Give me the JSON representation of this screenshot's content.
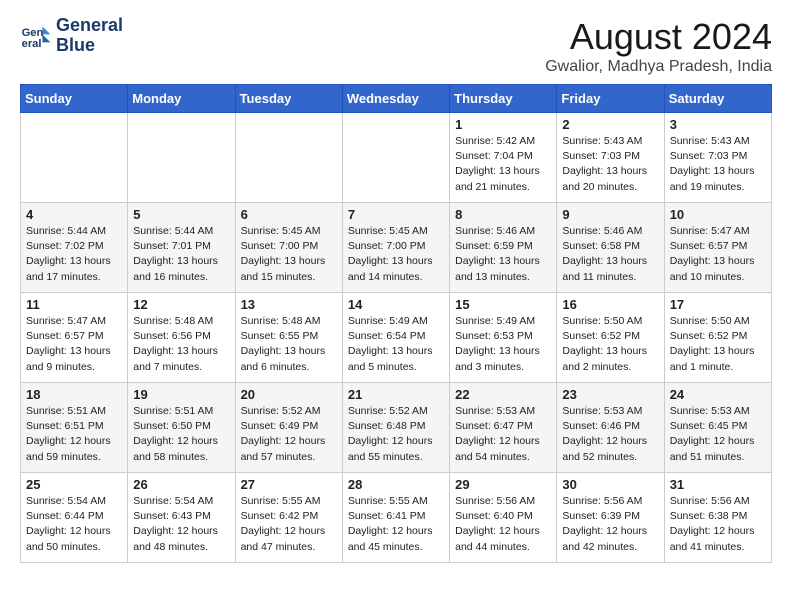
{
  "header": {
    "logo_line1": "General",
    "logo_line2": "Blue",
    "month": "August 2024",
    "location": "Gwalior, Madhya Pradesh, India"
  },
  "weekdays": [
    "Sunday",
    "Monday",
    "Tuesday",
    "Wednesday",
    "Thursday",
    "Friday",
    "Saturday"
  ],
  "weeks": [
    [
      {
        "day": "",
        "info": ""
      },
      {
        "day": "",
        "info": ""
      },
      {
        "day": "",
        "info": ""
      },
      {
        "day": "",
        "info": ""
      },
      {
        "day": "1",
        "info": "Sunrise: 5:42 AM\nSunset: 7:04 PM\nDaylight: 13 hours\nand 21 minutes."
      },
      {
        "day": "2",
        "info": "Sunrise: 5:43 AM\nSunset: 7:03 PM\nDaylight: 13 hours\nand 20 minutes."
      },
      {
        "day": "3",
        "info": "Sunrise: 5:43 AM\nSunset: 7:03 PM\nDaylight: 13 hours\nand 19 minutes."
      }
    ],
    [
      {
        "day": "4",
        "info": "Sunrise: 5:44 AM\nSunset: 7:02 PM\nDaylight: 13 hours\nand 17 minutes."
      },
      {
        "day": "5",
        "info": "Sunrise: 5:44 AM\nSunset: 7:01 PM\nDaylight: 13 hours\nand 16 minutes."
      },
      {
        "day": "6",
        "info": "Sunrise: 5:45 AM\nSunset: 7:00 PM\nDaylight: 13 hours\nand 15 minutes."
      },
      {
        "day": "7",
        "info": "Sunrise: 5:45 AM\nSunset: 7:00 PM\nDaylight: 13 hours\nand 14 minutes."
      },
      {
        "day": "8",
        "info": "Sunrise: 5:46 AM\nSunset: 6:59 PM\nDaylight: 13 hours\nand 13 minutes."
      },
      {
        "day": "9",
        "info": "Sunrise: 5:46 AM\nSunset: 6:58 PM\nDaylight: 13 hours\nand 11 minutes."
      },
      {
        "day": "10",
        "info": "Sunrise: 5:47 AM\nSunset: 6:57 PM\nDaylight: 13 hours\nand 10 minutes."
      }
    ],
    [
      {
        "day": "11",
        "info": "Sunrise: 5:47 AM\nSunset: 6:57 PM\nDaylight: 13 hours\nand 9 minutes."
      },
      {
        "day": "12",
        "info": "Sunrise: 5:48 AM\nSunset: 6:56 PM\nDaylight: 13 hours\nand 7 minutes."
      },
      {
        "day": "13",
        "info": "Sunrise: 5:48 AM\nSunset: 6:55 PM\nDaylight: 13 hours\nand 6 minutes."
      },
      {
        "day": "14",
        "info": "Sunrise: 5:49 AM\nSunset: 6:54 PM\nDaylight: 13 hours\nand 5 minutes."
      },
      {
        "day": "15",
        "info": "Sunrise: 5:49 AM\nSunset: 6:53 PM\nDaylight: 13 hours\nand 3 minutes."
      },
      {
        "day": "16",
        "info": "Sunrise: 5:50 AM\nSunset: 6:52 PM\nDaylight: 13 hours\nand 2 minutes."
      },
      {
        "day": "17",
        "info": "Sunrise: 5:50 AM\nSunset: 6:52 PM\nDaylight: 13 hours\nand 1 minute."
      }
    ],
    [
      {
        "day": "18",
        "info": "Sunrise: 5:51 AM\nSunset: 6:51 PM\nDaylight: 12 hours\nand 59 minutes."
      },
      {
        "day": "19",
        "info": "Sunrise: 5:51 AM\nSunset: 6:50 PM\nDaylight: 12 hours\nand 58 minutes."
      },
      {
        "day": "20",
        "info": "Sunrise: 5:52 AM\nSunset: 6:49 PM\nDaylight: 12 hours\nand 57 minutes."
      },
      {
        "day": "21",
        "info": "Sunrise: 5:52 AM\nSunset: 6:48 PM\nDaylight: 12 hours\nand 55 minutes."
      },
      {
        "day": "22",
        "info": "Sunrise: 5:53 AM\nSunset: 6:47 PM\nDaylight: 12 hours\nand 54 minutes."
      },
      {
        "day": "23",
        "info": "Sunrise: 5:53 AM\nSunset: 6:46 PM\nDaylight: 12 hours\nand 52 minutes."
      },
      {
        "day": "24",
        "info": "Sunrise: 5:53 AM\nSunset: 6:45 PM\nDaylight: 12 hours\nand 51 minutes."
      }
    ],
    [
      {
        "day": "25",
        "info": "Sunrise: 5:54 AM\nSunset: 6:44 PM\nDaylight: 12 hours\nand 50 minutes."
      },
      {
        "day": "26",
        "info": "Sunrise: 5:54 AM\nSunset: 6:43 PM\nDaylight: 12 hours\nand 48 minutes."
      },
      {
        "day": "27",
        "info": "Sunrise: 5:55 AM\nSunset: 6:42 PM\nDaylight: 12 hours\nand 47 minutes."
      },
      {
        "day": "28",
        "info": "Sunrise: 5:55 AM\nSunset: 6:41 PM\nDaylight: 12 hours\nand 45 minutes."
      },
      {
        "day": "29",
        "info": "Sunrise: 5:56 AM\nSunset: 6:40 PM\nDaylight: 12 hours\nand 44 minutes."
      },
      {
        "day": "30",
        "info": "Sunrise: 5:56 AM\nSunset: 6:39 PM\nDaylight: 12 hours\nand 42 minutes."
      },
      {
        "day": "31",
        "info": "Sunrise: 5:56 AM\nSunset: 6:38 PM\nDaylight: 12 hours\nand 41 minutes."
      }
    ]
  ]
}
